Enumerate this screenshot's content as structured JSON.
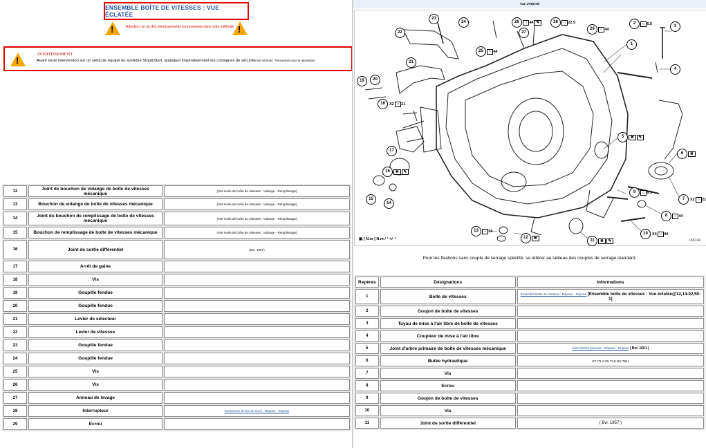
{
  "left": {
    "title": "ENSEMBLE BOÎTE DE VITESSES : VUE ÉCLATÉE",
    "attention_text": "Attention, un ou des avertissements sont présents dans cette méthode",
    "warning_head": "AVERTISSEMENT",
    "warning_body": "Avant toute intervention sur un véhicule équipé du système Stop&Start, appliquer impérativement les consignes de sécurité",
    "warning_ref": "(voir Véhicule : Précautions pour la réparation)",
    "rows": [
      {
        "num": "12",
        "des": "Joint de bouchon de vidange de boîte de vitesses mécanique",
        "info": "(Voir Huile de boîte de vitesses : Vidange - Remplissage)"
      },
      {
        "num": "13",
        "des": "Bouchon de vidange de boîte de vitesses mécanique",
        "info": "(Voir Huile de boîte de vitesses : Vidange - Remplissage)"
      },
      {
        "num": "14",
        "des": "Joint du bouchon de remplissage de boîte de vitesses mécanique",
        "info": "(Voir Huile de boîte de vitesses : Vidange - Remplissage)"
      },
      {
        "num": "15",
        "des": "Bouchon de remplissage de boîte de vitesses mécanique",
        "info": "(Voir Huile de boîte de vitesses : Vidange - Remplissage)"
      },
      {
        "num": "16",
        "des": "Joint de sortie différentiel",
        "info": "(Bvi. 1957)"
      },
      {
        "num": "17",
        "des": "Arrêt de gaine",
        "info": ""
      },
      {
        "num": "18",
        "des": "Vis",
        "info": ""
      },
      {
        "num": "19",
        "des": "Goupille fendue",
        "info": ""
      },
      {
        "num": "20",
        "des": "Goupille fendue",
        "info": ""
      },
      {
        "num": "21",
        "des": "Levier de sélecteur",
        "info": ""
      },
      {
        "num": "22",
        "des": "Levier de vitesses",
        "info": ""
      },
      {
        "num": "23",
        "des": "Goupille fendue",
        "info": ""
      },
      {
        "num": "24",
        "des": "Goupille fendue",
        "info": ""
      },
      {
        "num": "25",
        "des": "Vis",
        "info": ""
      },
      {
        "num": "26",
        "des": "Vis",
        "info": ""
      },
      {
        "num": "27",
        "des": "Anneau de levage",
        "info": ""
      },
      {
        "num": "28",
        "des": "Interrupteur",
        "info": "Contacteur de feu de recul : Dépose - Repose",
        "info_is_link": true
      },
      {
        "num": "29",
        "des": "Ecrou",
        "info": ""
      }
    ]
  },
  "right": {
    "ref_header": "TL8, UT8(UT8)",
    "legend": "[ N.m ] N.m / ° +/- °",
    "figure_id": "165744",
    "callouts": [
      "1",
      "2",
      "3",
      "4",
      "5",
      "6",
      "7",
      "8",
      "9",
      "10",
      "11",
      "12",
      "13",
      "14",
      "15",
      "16",
      "17",
      "18",
      "19",
      "20",
      "21",
      "22",
      "23",
      "24",
      "25",
      "26",
      "27",
      "28",
      "29"
    ],
    "torques": {
      "t2": "6.5",
      "t26": "44",
      "t28": "22.5",
      "t29": "44",
      "t25": "44",
      "t18": "21",
      "t9": "6.5",
      "t8": "44",
      "t10": "44",
      "t7": "21",
      "t13": "24",
      "x2": "X2",
      "x4": "X4"
    },
    "note": "Pour les fixations sans couple de serrage spécifié, se référer au tableau des couples de serrage standard.",
    "headers": [
      "Repères",
      "Désignations",
      "Informations"
    ],
    "rows": [
      {
        "num": "1",
        "des": "Boîte de vitesses",
        "info_link": "Ensemble boîte de vitesses : Dépose - Repose",
        "info": "[Ensemble boîte de vitesses : Vue éclatée@12,14-02,50-1]"
      },
      {
        "num": "2",
        "des": "Goujon de boîte de vitesses",
        "info": ""
      },
      {
        "num": "3",
        "des": "Tuyau de mise à l'air libre de boîte de vitesses",
        "info": ""
      },
      {
        "num": "4",
        "des": "Coupleur de mise à l'air libre",
        "info": ""
      },
      {
        "num": "5",
        "des": "Joint d'arbre primaire de boîte de vitesses mécanique",
        "info_link": "Joint d'arbre primaire : Dépose - Repose",
        "info": "( Bvi. 1601 )"
      },
      {
        "num": "6",
        "des": "Butée hydraulique",
        "info": "ET (TL4 OU TL8 OU T84)"
      },
      {
        "num": "7",
        "des": "Vis",
        "info": ""
      },
      {
        "num": "8",
        "des": "Ecrou",
        "info": ""
      },
      {
        "num": "9",
        "des": "Goujon de boîte de vitesses",
        "info": ""
      },
      {
        "num": "10",
        "des": "Vis",
        "info": ""
      },
      {
        "num": "11",
        "des": "Joint de sortie différentiel",
        "info": "( Bvi. 1957 )"
      }
    ]
  }
}
